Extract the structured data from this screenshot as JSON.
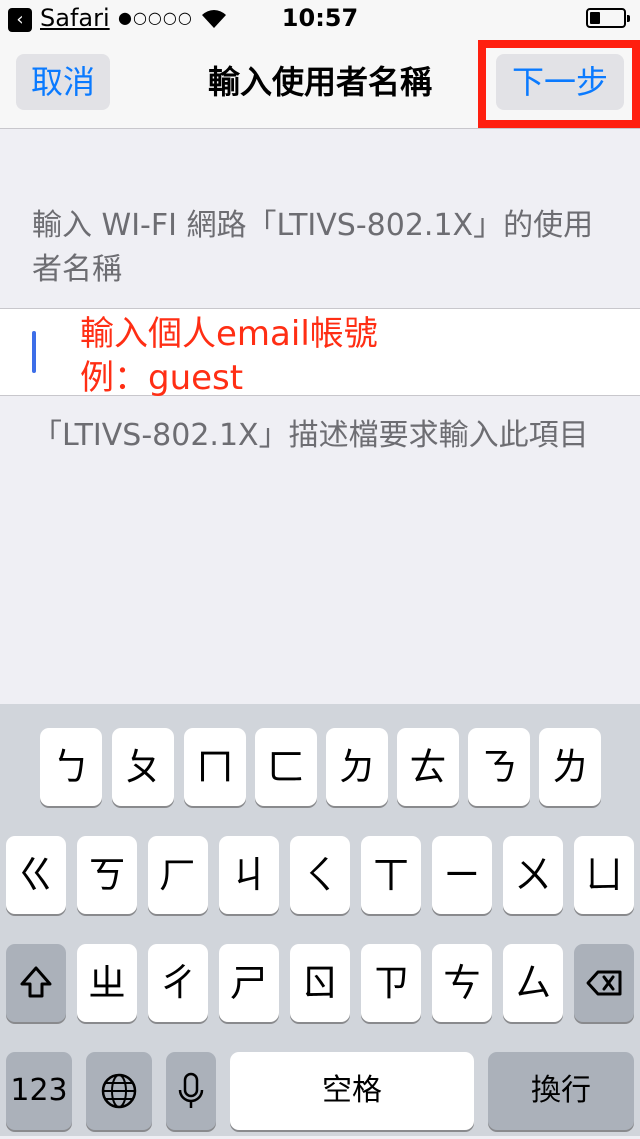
{
  "status_bar": {
    "app_name": "Safari",
    "signal": "●○○○○",
    "time": "10:57",
    "battery_level": 0.3
  },
  "nav": {
    "cancel_label": "取消",
    "title": "輸入使用者名稱",
    "next_label": "下一步"
  },
  "content": {
    "prompt": "輸入 WI-FI 網路「LTIVS-802.1X」的使用者名稱",
    "annotation_line1": "輸入個人email帳號",
    "annotation_line2": "例：guest",
    "footer_note": "「LTIVS-802.1X」描述檔要求輸入此項目"
  },
  "keyboard": {
    "row1": [
      "ㄅ",
      "ㄆ",
      "ㄇ",
      "ㄈ",
      "ㄉ",
      "ㄊ",
      "ㄋ",
      "ㄌ"
    ],
    "row2": [
      "ㄍ",
      "ㄎ",
      "ㄏ",
      "ㄐ",
      "ㄑ",
      "ㄒ",
      "ㄧ",
      "ㄨ",
      "ㄩ"
    ],
    "row3": [
      "ㄓ",
      "ㄔ",
      "ㄕ",
      "ㄖ",
      "ㄗ",
      "ㄘ",
      "ㄙ"
    ],
    "shift_icon": "shift-icon",
    "delete_icon": "delete-icon",
    "numbers_label": "123",
    "globe_icon": "globe-icon",
    "mic_icon": "microphone-icon",
    "space_label": "空格",
    "return_label": "換行"
  },
  "colors": {
    "accent": "#0a7aff",
    "highlight_box": "#ff1f0f",
    "annotation": "#ff2e14"
  }
}
